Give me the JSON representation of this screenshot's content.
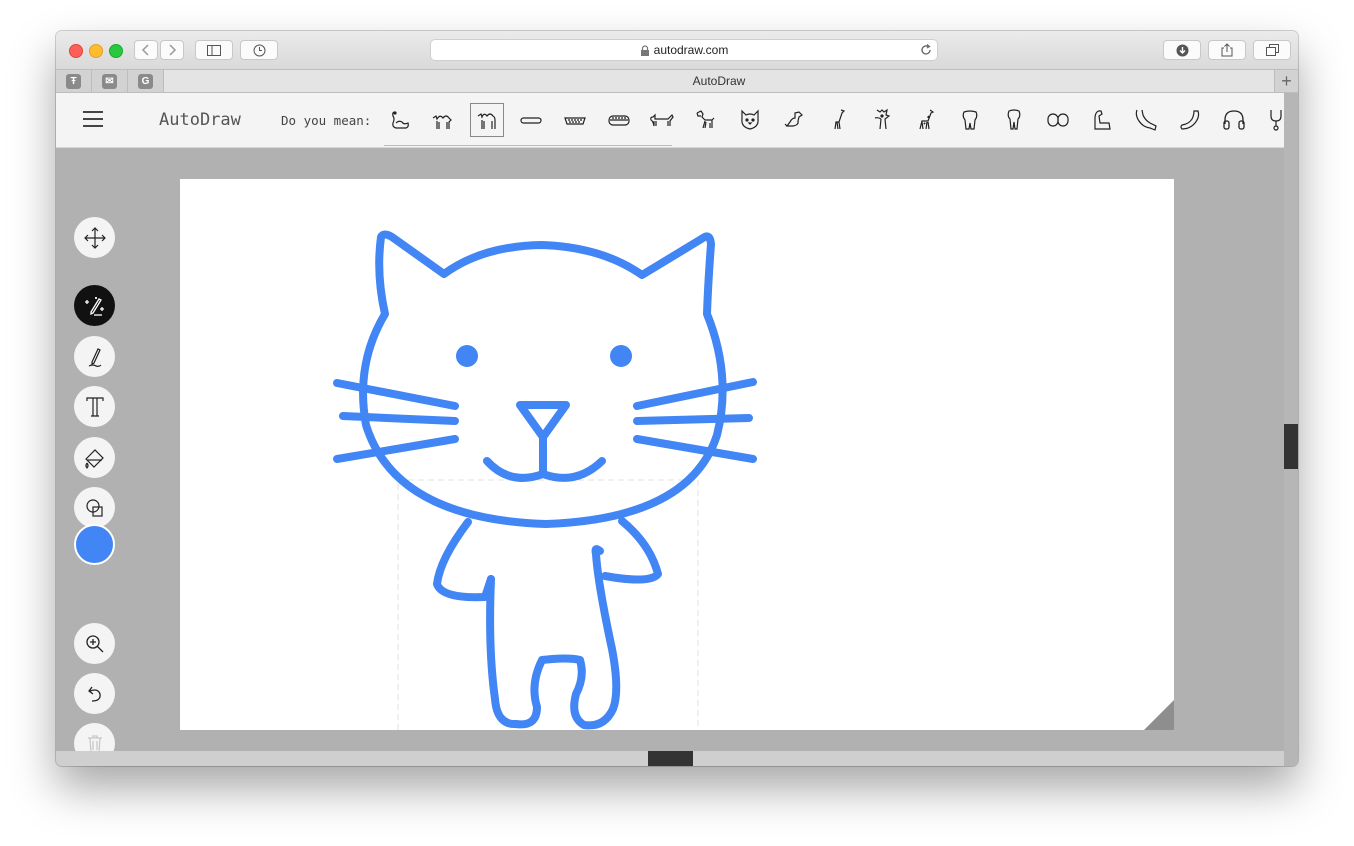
{
  "browser": {
    "url": "autodraw.com",
    "tab_title": "AutoDraw",
    "pinned_tabs": [
      "Ŧ",
      "✉",
      "G"
    ],
    "new_tab_glyph": "+"
  },
  "app": {
    "brand": "AutoDraw",
    "suggestion_prompt": "Do you mean:",
    "suggestions": [
      "swan",
      "camel",
      "camel-selected",
      "hot-dog",
      "bread",
      "hot-dog-bun",
      "dachshund",
      "dog",
      "cat-face",
      "dog-sitting",
      "giraffe",
      "giraffe-figure",
      "giraffe-2",
      "tooth",
      "tooth-2",
      "teeth",
      "elbow",
      "arm",
      "arm-2",
      "headphones",
      "stethoscope"
    ],
    "selected_suggestion": "camel",
    "accent_color": "#4285f4",
    "drawing_color": "#4285f4",
    "tools": [
      "move-icon",
      "autodraw-icon",
      "pen-icon",
      "text-icon",
      "fill-icon",
      "shapes-icon",
      "color-swatch",
      "zoom-icon",
      "undo-icon",
      "trash-icon"
    ],
    "active_tool": "autodraw"
  }
}
